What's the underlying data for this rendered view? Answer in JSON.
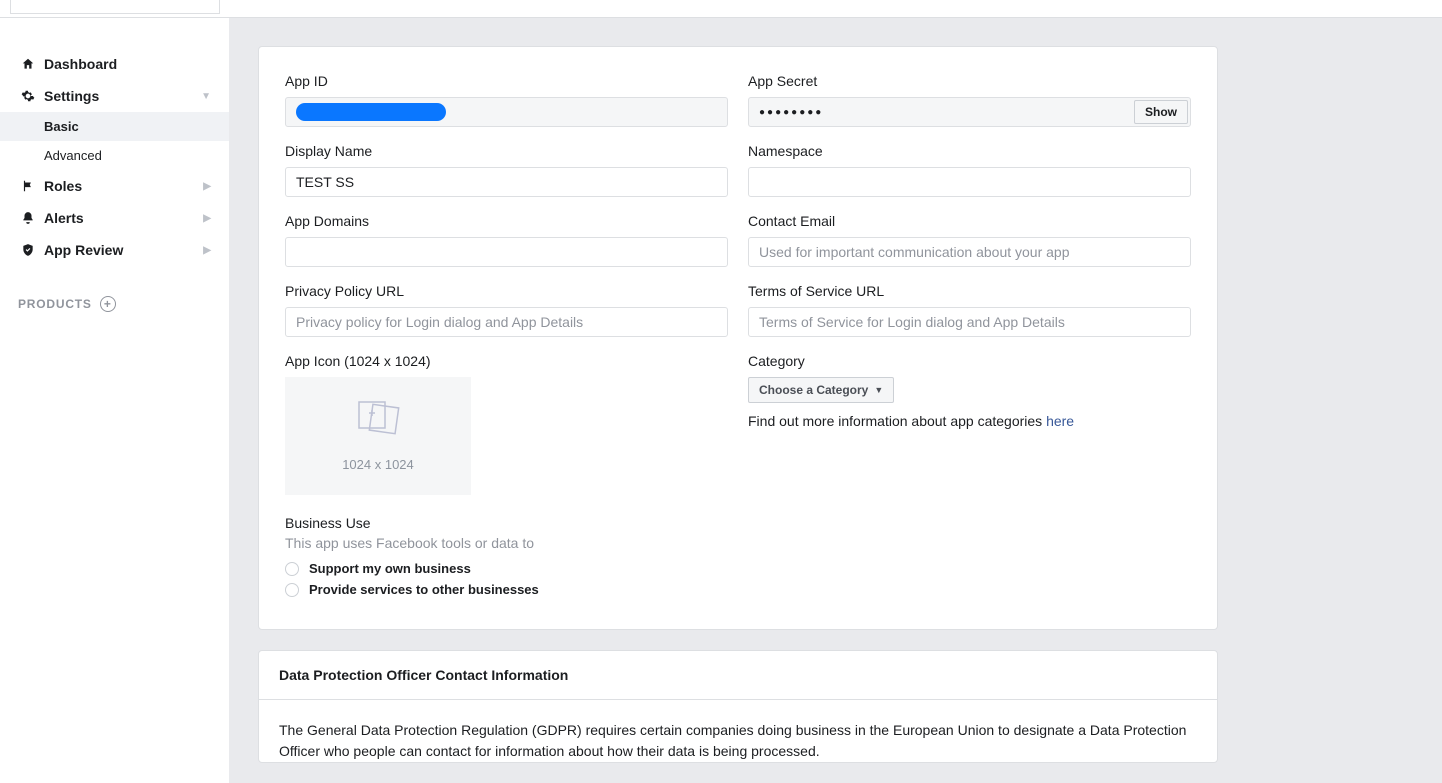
{
  "sidebar": {
    "items": [
      {
        "label": "Dashboard"
      },
      {
        "label": "Settings"
      },
      {
        "label": "Roles"
      },
      {
        "label": "Alerts"
      },
      {
        "label": "App Review"
      }
    ],
    "settings_children": [
      {
        "label": "Basic",
        "active": true
      },
      {
        "label": "Advanced",
        "active": false
      }
    ],
    "products_label": "PRODUCTS"
  },
  "form": {
    "app_id": {
      "label": "App ID"
    },
    "app_secret": {
      "label": "App Secret",
      "masked": "●●●●●●●●",
      "show_label": "Show"
    },
    "display_name": {
      "label": "Display Name",
      "value": "TEST SS"
    },
    "namespace": {
      "label": "Namespace",
      "value": ""
    },
    "app_domains": {
      "label": "App Domains",
      "value": ""
    },
    "contact_email": {
      "label": "Contact Email",
      "value": "",
      "placeholder": "Used for important communication about your app"
    },
    "privacy_url": {
      "label": "Privacy Policy URL",
      "value": "",
      "placeholder": "Privacy policy for Login dialog and App Details"
    },
    "tos_url": {
      "label": "Terms of Service URL",
      "value": "",
      "placeholder": "Terms of Service for Login dialog and App Details"
    },
    "app_icon": {
      "label": "App Icon (1024 x 1024)",
      "dim_text": "1024 x 1024"
    },
    "category": {
      "label": "Category",
      "selected": "Choose a Category",
      "help_prefix": "Find out more information about app categories ",
      "help_link": "here"
    },
    "business_use": {
      "label": "Business Use",
      "desc": "This app uses Facebook tools or data to",
      "options": [
        "Support my own business",
        "Provide services to other businesses"
      ]
    }
  },
  "dpo": {
    "title": "Data Protection Officer Contact Information",
    "body": "The General Data Protection Regulation (GDPR) requires certain companies doing business in the European Union to designate a Data Protection Officer who people can contact for information about how their data is being processed."
  }
}
